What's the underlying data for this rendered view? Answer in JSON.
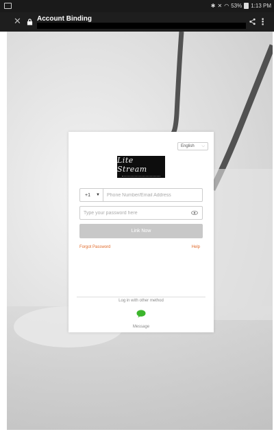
{
  "status_bar": {
    "battery": "53%",
    "time": "1:13 PM"
  },
  "title_bar": {
    "title": "Account Binding"
  },
  "card": {
    "language": "English",
    "logo_text": "Lite Stream",
    "country_code": "+1",
    "phone_placeholder": "Phone Number/Email Address",
    "password_placeholder": "Type your password here",
    "link_button": "Link Now",
    "forgot_password": "Forgot Password",
    "help": "Help",
    "other_method": "Log in with other method",
    "message_label": "Message"
  },
  "colors": {
    "accent": "#e06a2a",
    "message_green": "#3cb52c",
    "button_disabled": "#c8c8c8"
  }
}
